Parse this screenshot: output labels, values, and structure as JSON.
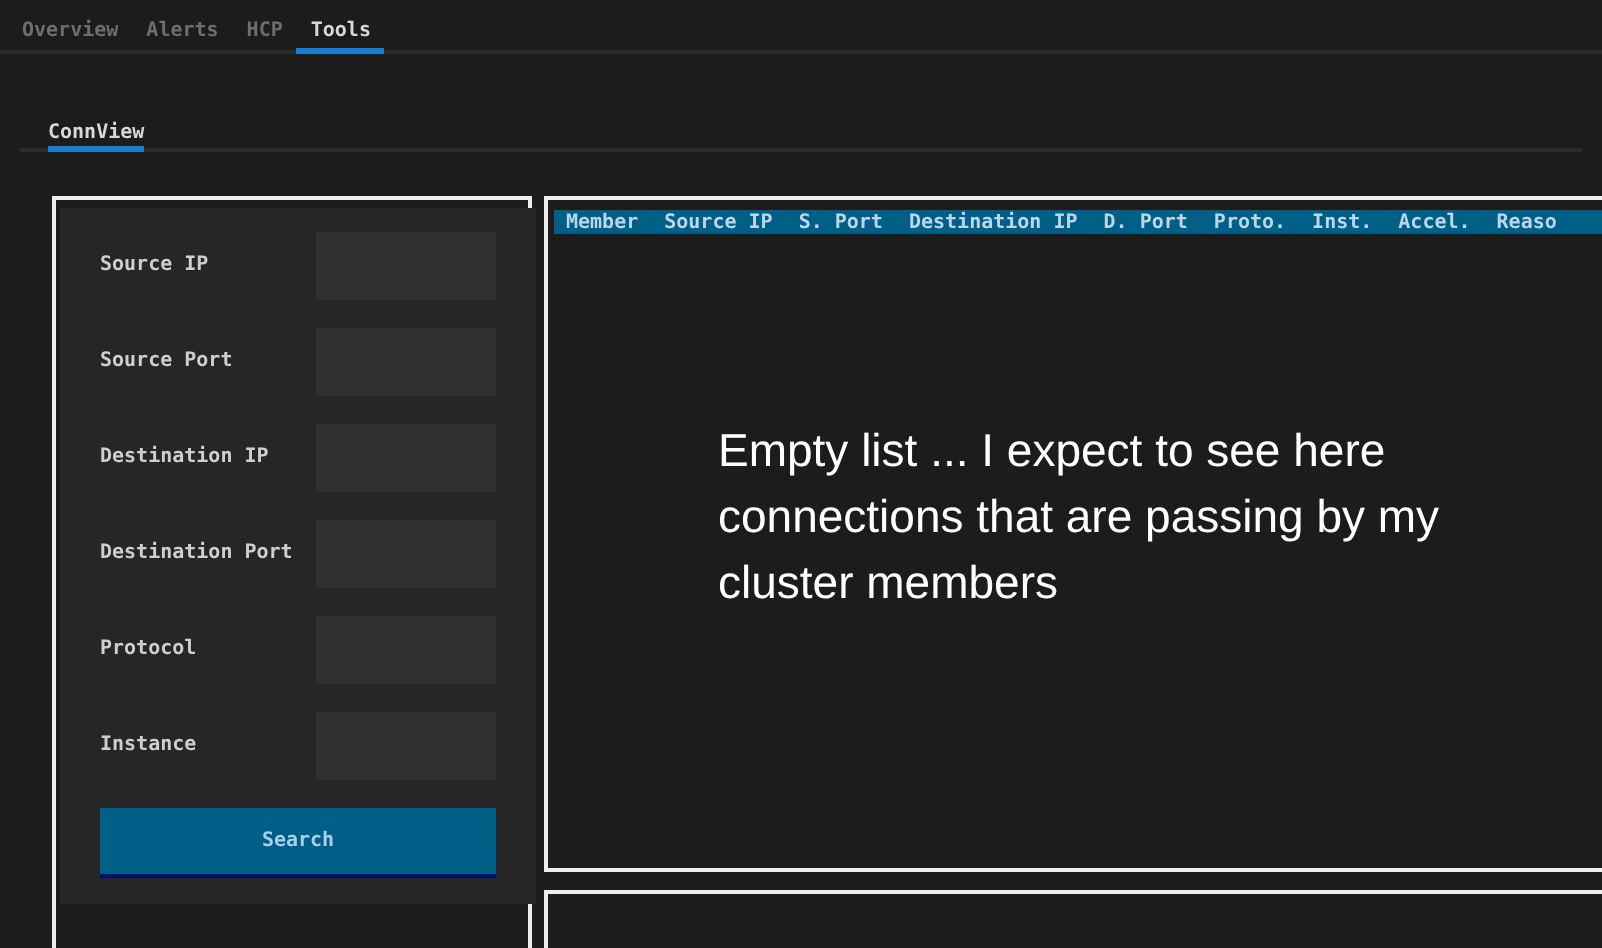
{
  "tabs": [
    {
      "label": "Overview",
      "selected": false
    },
    {
      "label": "Alerts",
      "selected": false
    },
    {
      "label": "HCP",
      "selected": false
    },
    {
      "label": "Tools",
      "selected": true
    }
  ],
  "subtabs": [
    {
      "label": "ConnView",
      "selected": true
    }
  ],
  "filter_form": {
    "fields": [
      {
        "label": "Source IP"
      },
      {
        "label": "Source Port"
      },
      {
        "label": "Destination IP"
      },
      {
        "label": "Destination Port"
      },
      {
        "label": "Protocol"
      },
      {
        "label": "Instance"
      }
    ],
    "button": "Search"
  },
  "table": {
    "columns": [
      "Member",
      "Source IP",
      "S. Port",
      "Destination IP",
      "D. Port",
      "Proto.",
      "Inst.",
      "Accel.",
      "Reaso"
    ]
  },
  "annotation": "Empty list ... I expect to see here connections that are passing by my cluster members"
}
